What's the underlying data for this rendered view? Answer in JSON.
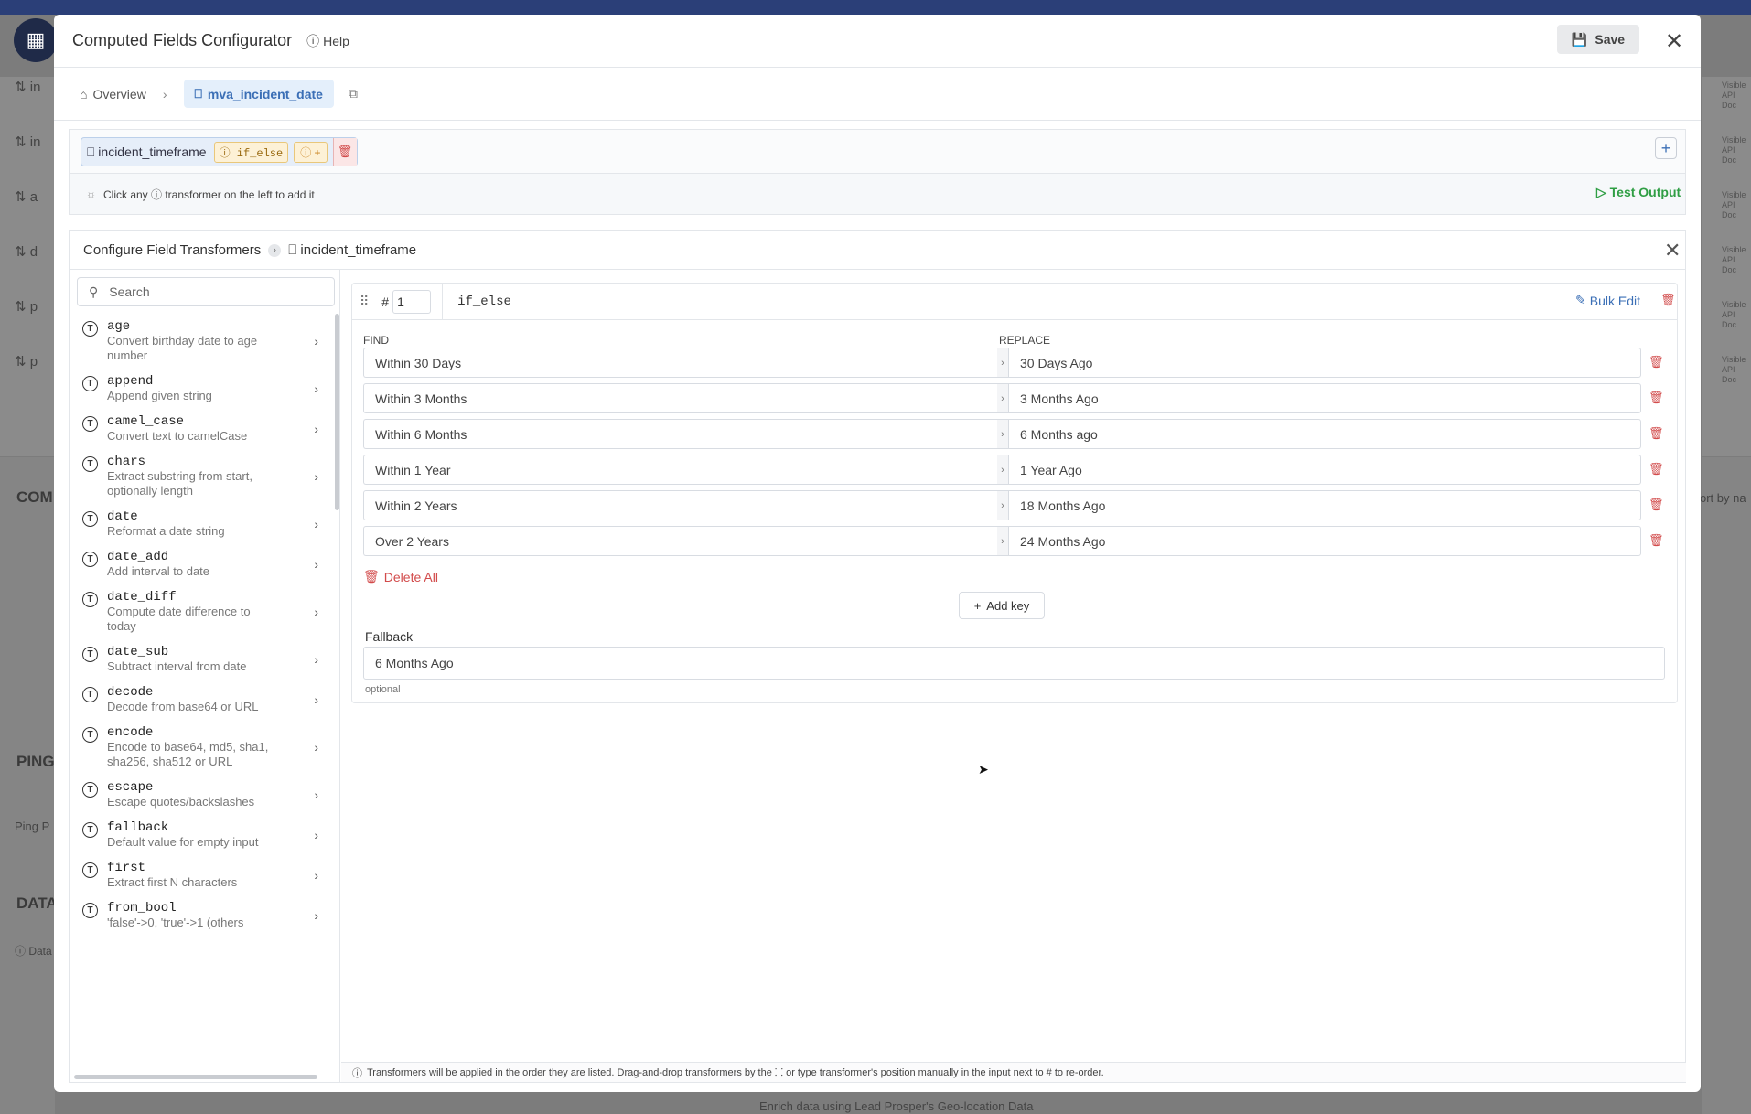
{
  "background": {
    "rows": [
      "in",
      "in",
      "a",
      "d",
      "p",
      "p"
    ],
    "sections": [
      "COM",
      "PING",
      "DATA"
    ],
    "ping_label": "Ping P",
    "data_label": "Data",
    "sort_label": "ort by na",
    "right_labels": [
      "Visible API Doc",
      "Visible API Doc",
      "Visible API Doc",
      "Visible API Doc",
      "Visible API Doc",
      "Visible API Doc"
    ],
    "bottom_text": "Enrich data using Lead Prosper's Geo-location Data"
  },
  "header": {
    "title": "Computed Fields Configurator",
    "help": "Help",
    "save": "Save"
  },
  "breadcrumb": {
    "home": "Overview",
    "active": "mva_incident_date"
  },
  "field": {
    "name": "incident_timeframe",
    "transformer_badge": "if_else",
    "add_badge": "+"
  },
  "hint": {
    "text": "Click any ⓘ transformer on the left to add it",
    "test_output": "Test Output"
  },
  "config": {
    "title": "Configure Field Transformers",
    "field": "incident_timeframe"
  },
  "sidebar": {
    "search_placeholder": "Search",
    "items": [
      {
        "name": "age",
        "desc": "Convert birthday date to age number"
      },
      {
        "name": "append",
        "desc": "Append given string"
      },
      {
        "name": "camel_case",
        "desc": "Convert text to camelCase"
      },
      {
        "name": "chars",
        "desc": "Extract substring from start, optionally length"
      },
      {
        "name": "date",
        "desc": "Reformat a date string"
      },
      {
        "name": "date_add",
        "desc": "Add interval to date"
      },
      {
        "name": "date_diff",
        "desc": "Compute date difference to today"
      },
      {
        "name": "date_sub",
        "desc": "Subtract interval from date"
      },
      {
        "name": "decode",
        "desc": "Decode from base64 or URL"
      },
      {
        "name": "encode",
        "desc": "Encode to base64, md5, sha1, sha256, sha512 or URL"
      },
      {
        "name": "escape",
        "desc": "Escape quotes/backslashes"
      },
      {
        "name": "fallback",
        "desc": "Default value for empty input"
      },
      {
        "name": "first",
        "desc": "Extract first N characters"
      },
      {
        "name": "from_bool",
        "desc": "'false'->0, 'true'->1 (others"
      }
    ]
  },
  "transformer": {
    "position": "1",
    "name": "if_else",
    "bulk_edit": "Bulk Edit",
    "find_header": "FIND",
    "replace_header": "REPLACE",
    "rows": [
      {
        "find": "Within 30 Days",
        "replace": "30 Days Ago"
      },
      {
        "find": "Within 3 Months",
        "replace": "3 Months Ago"
      },
      {
        "find": "Within 6 Months",
        "replace": "6 Months ago"
      },
      {
        "find": "Within 1 Year",
        "replace": "1 Year Ago"
      },
      {
        "find": "Within 2 Years",
        "replace": "18 Months Ago"
      },
      {
        "find": "Over 2 Years",
        "replace": "24 Months Ago"
      }
    ],
    "delete_all": "Delete All",
    "add_key": "Add key",
    "fallback_label": "Fallback",
    "fallback_value": "6 Months Ago",
    "fallback_hint": "optional"
  },
  "footer": {
    "note": "Transformers will be applied in the order they are listed. Drag-and-drop transformers by the ⸬ or type transformer's position manually in the input next to # to re-order."
  }
}
